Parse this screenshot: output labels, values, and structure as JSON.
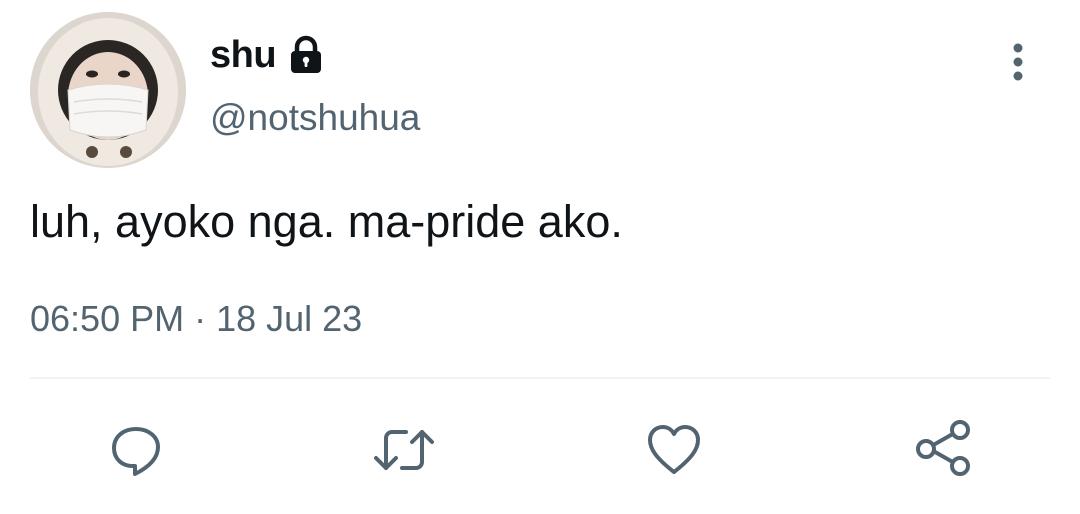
{
  "tweet": {
    "author": {
      "display_name": "shu",
      "handle": "@notshuhua",
      "protected_icon": "lock-icon",
      "avatar": "profile-photo"
    },
    "menu_icon": "more-vertical-icon",
    "text": "luh, ayoko nga. ma-pride ako.",
    "timestamp": "06:50 PM · 18 Jul 23"
  },
  "actions": [
    {
      "name": "reply",
      "icon": "reply-icon"
    },
    {
      "name": "retweet",
      "icon": "retweet-icon"
    },
    {
      "name": "like",
      "icon": "heart-icon"
    },
    {
      "name": "share",
      "icon": "share-icon"
    }
  ],
  "colors": {
    "text_primary": "#0f1419",
    "text_secondary": "#536471",
    "divider": "#eff3f4",
    "icon": "#536471"
  }
}
